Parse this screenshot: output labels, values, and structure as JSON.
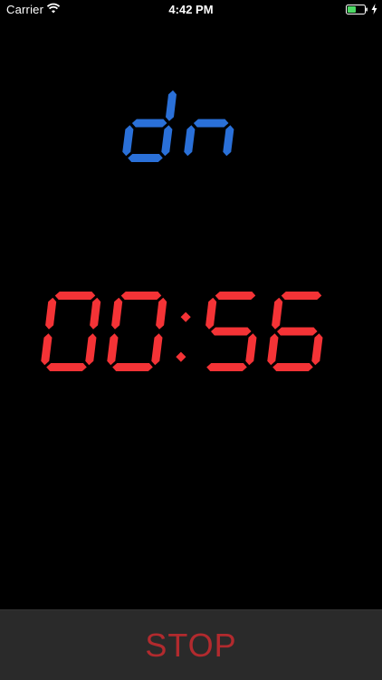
{
  "status_bar": {
    "carrier": "Carrier",
    "time": "4:42 PM",
    "battery_level": 0.5
  },
  "mode_display": {
    "text": "dn",
    "color": "#2a70d8"
  },
  "countdown": {
    "text": "00:56",
    "color": "#f43336"
  },
  "stop_button": {
    "label": "STOP",
    "color": "#b22a2e"
  }
}
